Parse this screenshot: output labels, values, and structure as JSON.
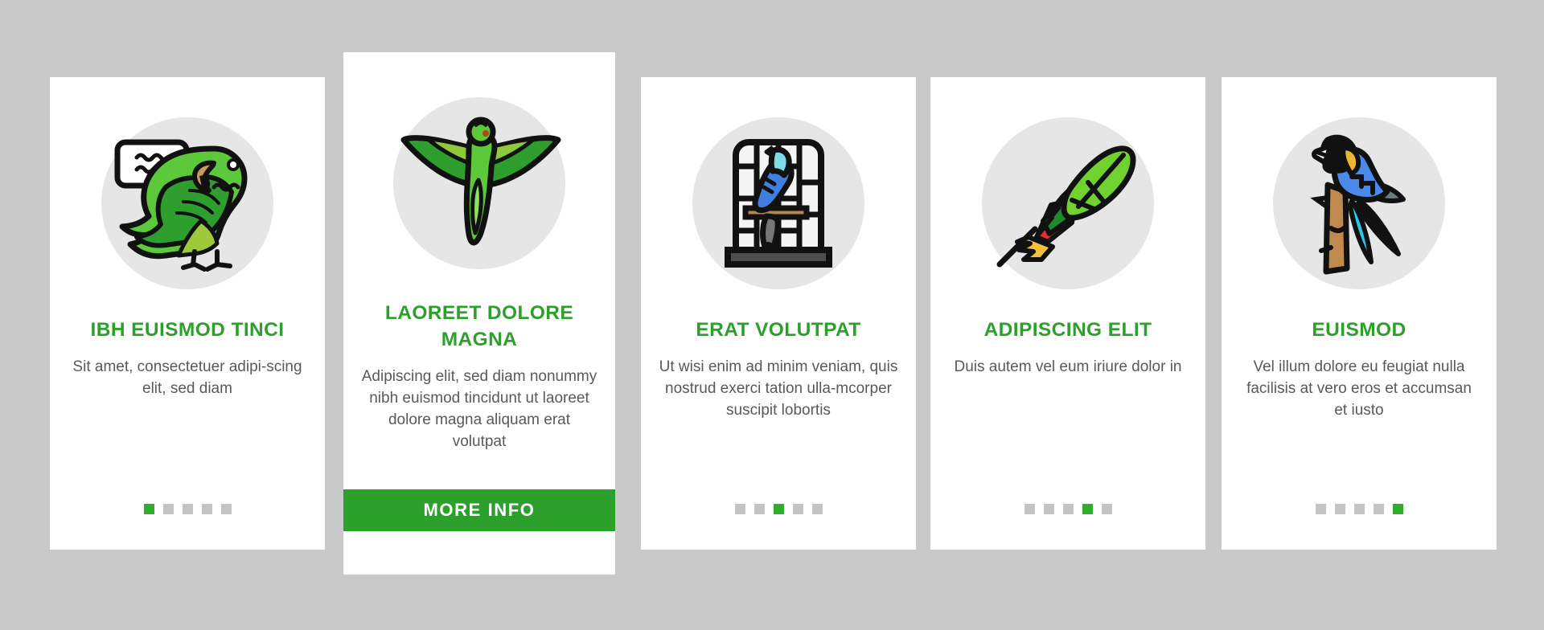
{
  "theme": {
    "background": "#c9c9c9",
    "card_background": "#ffffff",
    "accent_green": "#2ba02b",
    "dot_active": "#2fad2f",
    "dot_inactive": "#c4c4c4",
    "title_color": "#2ba02b",
    "body_text_color": "#595959",
    "icon_circle_color": "#e6e6e6"
  },
  "cards": [
    {
      "id": "card-talking-parrot",
      "featured": false,
      "icon_name": "talking-parrot-icon",
      "title": "IBH EUISMOD TINCI",
      "description": "Sit amet, consectetuer adipi-scing elit, sed diam",
      "dots": {
        "count": 5,
        "active_index": 0
      }
    },
    {
      "id": "card-flying-bird",
      "featured": true,
      "icon_name": "flying-parrot-icon",
      "title": "LAOREET DOLORE MAGNA",
      "description": "Adipiscing elit, sed diam nonummy nibh euismod tincidunt ut laoreet dolore magna aliquam erat volutpat",
      "button_label": "MORE INFO",
      "dots": {
        "count": 0,
        "active_index": -1
      }
    },
    {
      "id": "card-bird-cage",
      "featured": false,
      "icon_name": "caged-bird-icon",
      "title": "ERAT VOLUTPAT",
      "description": "Ut wisi enim ad minim veniam, quis nostrud exerci tation ulla-mcorper suscipit lobortis",
      "dots": {
        "count": 5,
        "active_index": 2
      }
    },
    {
      "id": "card-feather",
      "featured": false,
      "icon_name": "parrot-feather-icon",
      "title": "ADIPISCING ELIT",
      "description": "Duis autem vel eum iriure dolor in",
      "dots": {
        "count": 5,
        "active_index": 3
      }
    },
    {
      "id": "card-macaw",
      "featured": false,
      "icon_name": "macaw-on-perch-icon",
      "title": "EUISMOD",
      "description": "Vel illum dolore eu feugiat nulla facilisis at vero eros et accumsan et iusto",
      "dots": {
        "count": 5,
        "active_index": 4
      }
    }
  ]
}
